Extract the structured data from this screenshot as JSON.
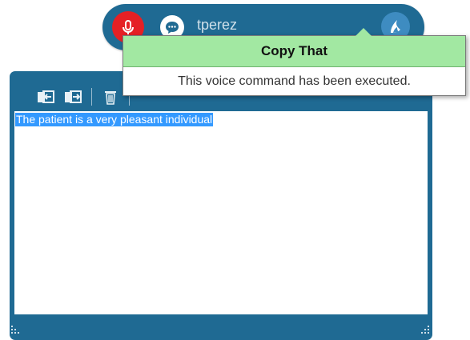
{
  "user": {
    "name": "tperez"
  },
  "toast": {
    "title": "Copy That",
    "message": "This voice command has been executed."
  },
  "editor": {
    "selected_text": "The patient is a very pleasant individual"
  },
  "colors": {
    "bar": "#1f6a93",
    "mic_active": "#e52025",
    "toast_header": "#a2e8a2",
    "selection": "#3399ff"
  },
  "icons": {
    "mic": "microphone-icon",
    "chat": "chat-bubble-icon",
    "logo": "dragon-icon",
    "transfer_in": "transfer-in-icon",
    "transfer_out": "transfer-out-icon",
    "delete": "trash-icon"
  }
}
